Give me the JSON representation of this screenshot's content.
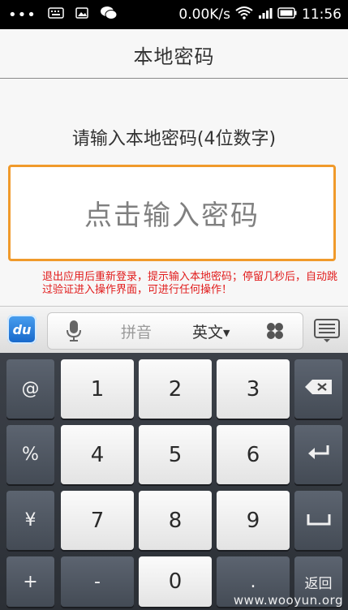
{
  "status_bar": {
    "left_icons": [
      "more-dots-icon",
      "keyboard-icon",
      "image-icon",
      "wechat-icon"
    ],
    "net_speed": "0.00K/s",
    "right_icons": [
      "wifi-icon",
      "signal-icon",
      "battery-icon"
    ],
    "time": "11:56"
  },
  "header": {
    "title": "本地密码"
  },
  "main": {
    "prompt": "请输入本地密码(4位数字)",
    "password_placeholder": "点击输入密码",
    "annotation": "退出应用后重新登录，提示输入本地密码；停留几秒后，自动跳过验证进入操作界面，可进行任何操作！"
  },
  "ime_toolbar": {
    "logo": "du",
    "pinyin": "拼音",
    "english": "英文",
    "icons": [
      "mic-icon",
      "clover-icon",
      "keyboard-hide-icon",
      "chevron-down-icon"
    ],
    "accent_color": "#f09a2b"
  },
  "keyboard": {
    "rows": [
      [
        "@",
        "1",
        "2",
        "3",
        "⌫"
      ],
      [
        "%",
        "4",
        "5",
        "6",
        "↵"
      ],
      [
        "¥",
        "7",
        "8",
        "9",
        "␣"
      ],
      [
        "+",
        "-",
        "0",
        ".",
        "返回"
      ]
    ]
  },
  "watermark": "www.wooyun.org"
}
